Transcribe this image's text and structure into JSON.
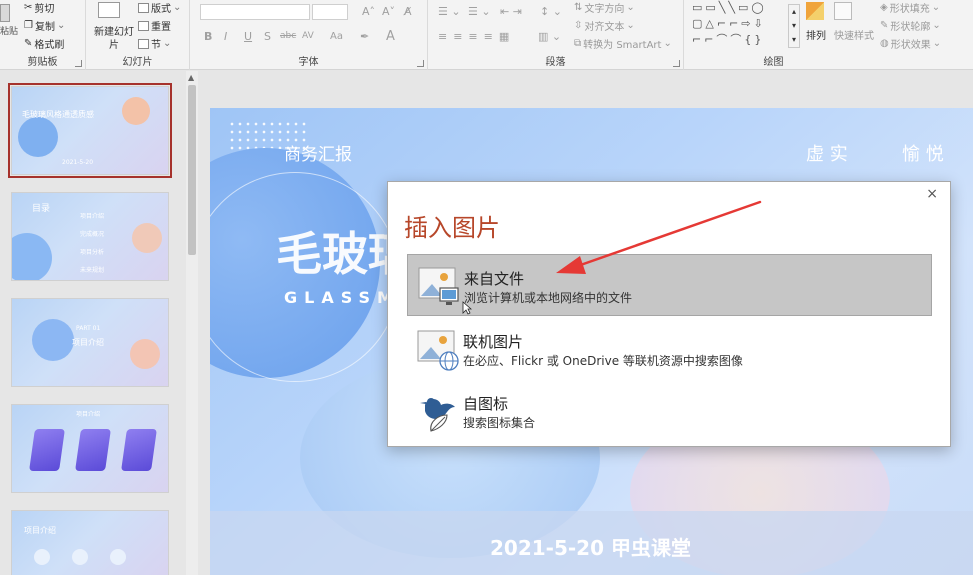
{
  "ribbon": {
    "clipboard": {
      "paste": "粘贴",
      "cut": "剪切",
      "copy": "复制",
      "format_painter": "格式刷",
      "label": "剪贴板"
    },
    "slides": {
      "new_slide": "新建幻灯片",
      "layout": "版式",
      "reset": "重置",
      "section": "节",
      "label": "幻灯片"
    },
    "font": {
      "label": "字体",
      "bold": "B",
      "italic": "I",
      "underline": "U",
      "shadow": "S",
      "strike": "abc",
      "spacing": "AV",
      "case": "Aa",
      "color": "A"
    },
    "paragraph": {
      "text_direction": "文字方向",
      "align_text": "对齐文本",
      "smartart": "转换为 SmartArt",
      "label": "段落"
    },
    "drawing": {
      "arrange": "排列",
      "quick_styles": "快速样式",
      "shape_fill": "形状填充",
      "shape_outline": "形状轮廓",
      "shape_effects": "形状效果",
      "label": "绘图"
    }
  },
  "slide": {
    "header_left": "商务汇报",
    "header_right_1": "虚 实",
    "header_right_2": "愉 悦",
    "main_title": "毛玻璃",
    "sub_title": "GLASSM",
    "footer": "2021-5-20  甲虫课堂"
  },
  "thumbnails": [
    {
      "title": "毛玻璃风格通透质感",
      "date": "2021-5-20"
    },
    {
      "title": "目录",
      "items": [
        "项目介绍",
        "完成概况",
        "项目分析",
        "未来规划"
      ]
    },
    {
      "title": "PART 01",
      "sub": "项目介绍"
    },
    {
      "title": "项目介绍"
    },
    {
      "title": "项目介绍"
    }
  ],
  "dialog": {
    "title": "插入图片",
    "close": "×",
    "options": [
      {
        "title": "来自文件",
        "desc": "浏览计算机或本地网络中的文件"
      },
      {
        "title": "联机图片",
        "desc": "在必应、Flickr 或 OneDrive 等联机资源中搜索图像"
      },
      {
        "title": "自图标",
        "desc": "搜索图标集合"
      }
    ]
  },
  "colors": {
    "accent": "#b7472a",
    "arrow": "#e53935",
    "selected_thumb": "#a6322c"
  }
}
